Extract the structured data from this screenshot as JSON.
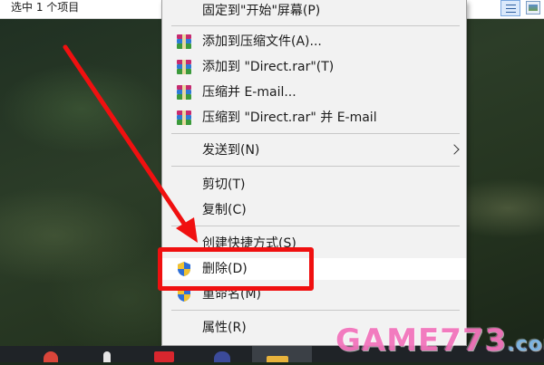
{
  "explorer": {
    "status_text": "选中 1 个项目"
  },
  "context_menu": {
    "items": [
      {
        "label": "固定到\"开始\"屏幕(P)",
        "icon": ""
      },
      {
        "label": "添加到压缩文件(A)...",
        "icon": "winrar-icon"
      },
      {
        "label": "添加到 \"Direct.rar\"(T)",
        "icon": "winrar-icon"
      },
      {
        "label": "压缩并 E-mail...",
        "icon": "winrar-icon"
      },
      {
        "label": "压缩到 \"Direct.rar\" 并 E-mail",
        "icon": "winrar-icon"
      },
      {
        "label": "发送到(N)",
        "icon": "",
        "submenu": true
      },
      {
        "label": "剪切(T)",
        "icon": ""
      },
      {
        "label": "复制(C)",
        "icon": ""
      },
      {
        "label": "创建快捷方式(S)",
        "icon": ""
      },
      {
        "label": "删除(D)",
        "icon": "uac-shield-icon",
        "highlighted": true
      },
      {
        "label": "重命名(M)",
        "icon": "uac-shield-icon"
      },
      {
        "label": "属性(R)",
        "icon": ""
      }
    ]
  },
  "annotation": {
    "color": "#f01010",
    "target": "删除(D)"
  },
  "watermark": {
    "brand": "GAME773",
    "suffix": ".com"
  },
  "colors": {
    "menu_bg": "#f2f2f2",
    "highlight_bg": "#ffffff",
    "taskbar_bg": "#1f2327"
  }
}
